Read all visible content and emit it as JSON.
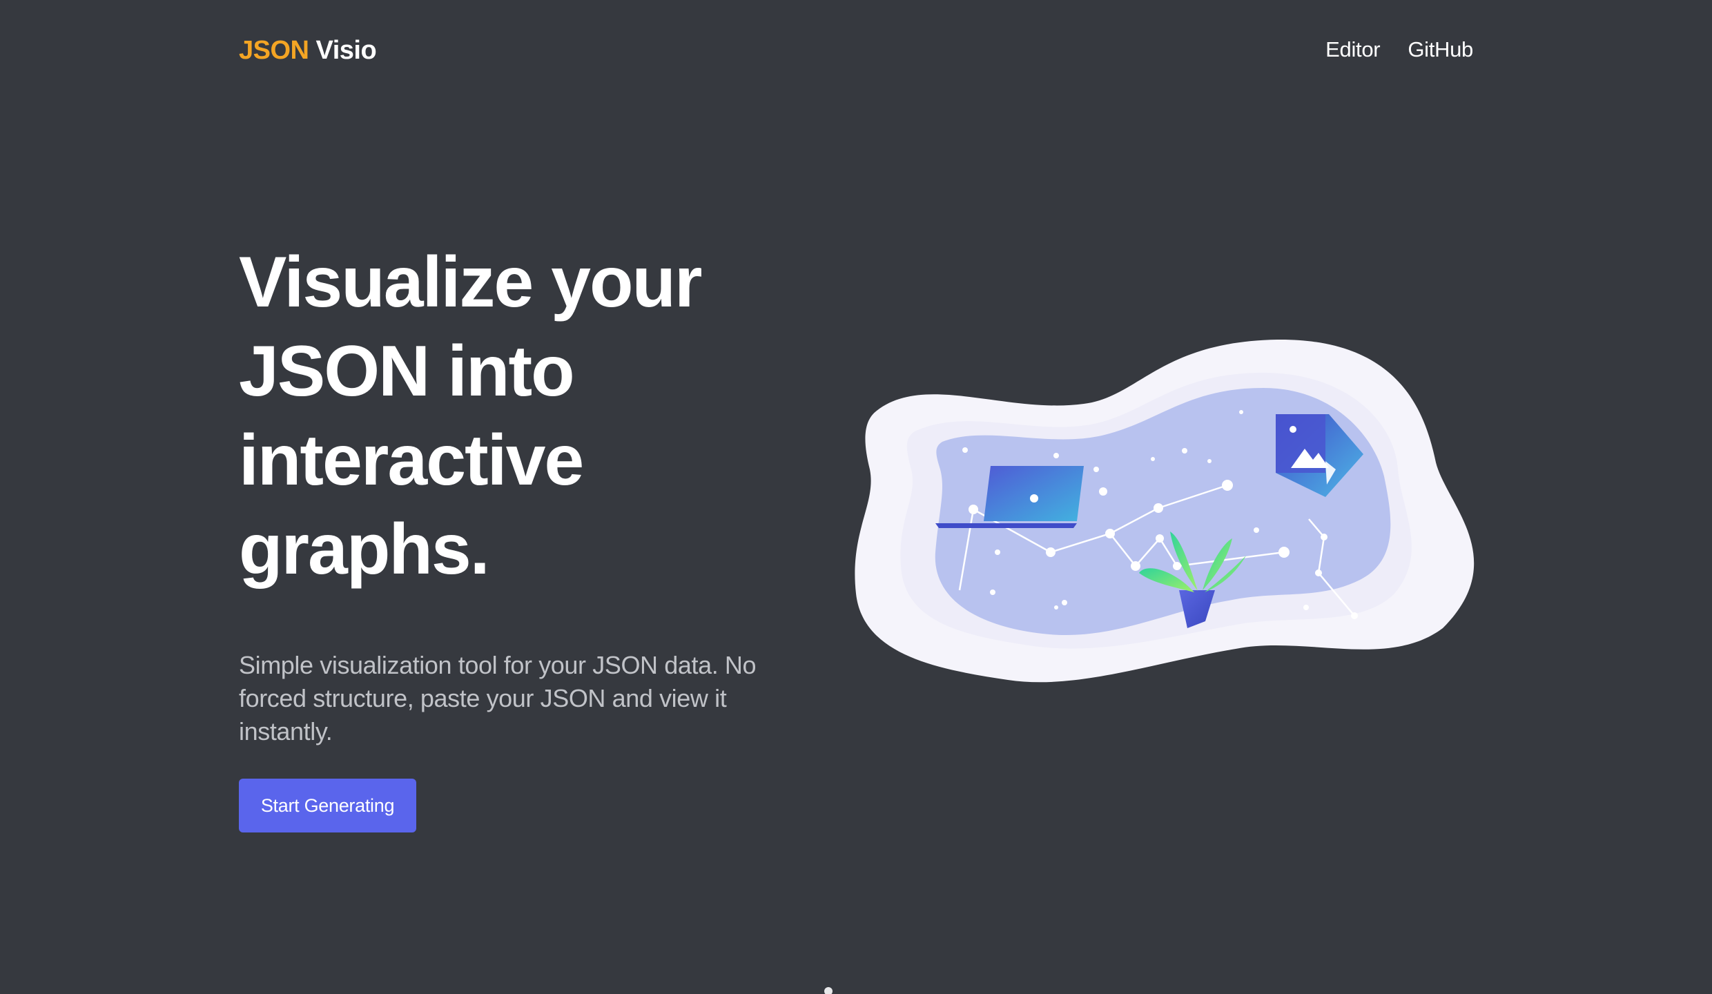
{
  "navbar": {
    "brand_accent": "JSON",
    "brand_main": "Visio",
    "links": [
      {
        "label": "Editor"
      },
      {
        "label": "GitHub"
      }
    ]
  },
  "hero": {
    "title": "Visualize your JSON into interactive graphs.",
    "subtitle": "Simple visualization tool for your JSON data. No forced structure, paste your JSON and view it instantly.",
    "cta_label": "Start Generating"
  },
  "colors": {
    "background": "#36393f",
    "brand_accent": "#f4a524",
    "cta": "#5a65ec",
    "subtitle_text": "#c1c3c8"
  },
  "icons": {
    "illustration": "graph-network-illustration"
  }
}
